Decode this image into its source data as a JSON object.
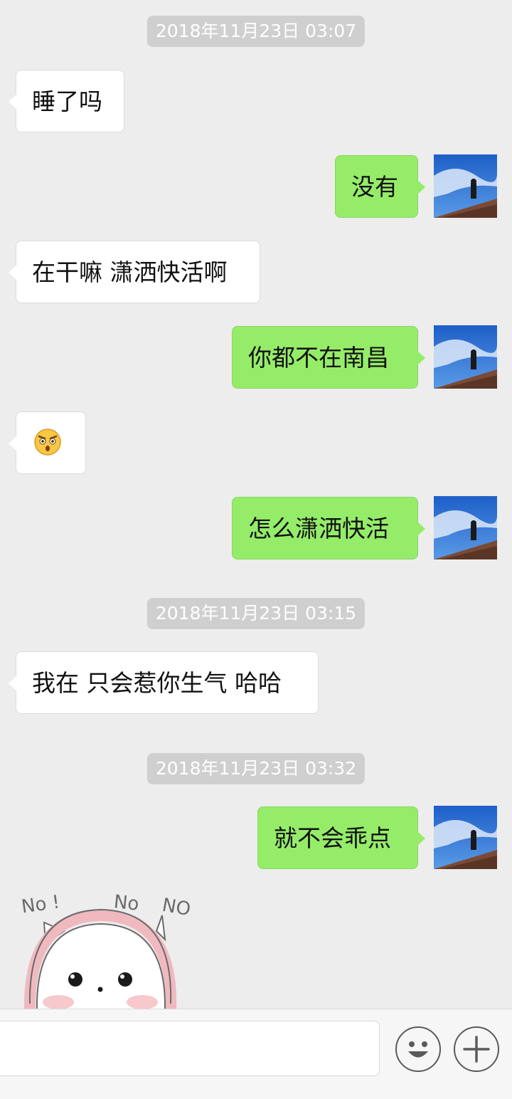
{
  "timestamps": [
    "2018年11月23日 03:07",
    "2018年11月23日 03:15",
    "2018年11月23日 03:32"
  ],
  "messages": [
    {
      "side": "in",
      "text": "睡了吗"
    },
    {
      "side": "out",
      "text": "没有"
    },
    {
      "side": "in",
      "text": "在干嘛 潇洒快活啊"
    },
    {
      "side": "out",
      "text": "你都不在南昌"
    },
    {
      "side": "in",
      "emoji": "angry-surprised-face"
    },
    {
      "side": "out",
      "text": "怎么潇洒快活"
    },
    {
      "side": "in",
      "text": "我在 只会惹你生气 哈哈"
    },
    {
      "side": "out",
      "text": "就不会乖点"
    }
  ],
  "sticker": {
    "words": [
      "No !",
      "No",
      "NO"
    ]
  },
  "input_bar": {
    "message_value": "",
    "emoji_button_icon": "smile-face-icon",
    "more_button_icon": "plus-icon"
  },
  "colors": {
    "background": "#ededed",
    "outgoing_bubble": "#95ec69",
    "incoming_bubble": "#ffffff",
    "timestamp_bg": "#cfcfcf"
  }
}
